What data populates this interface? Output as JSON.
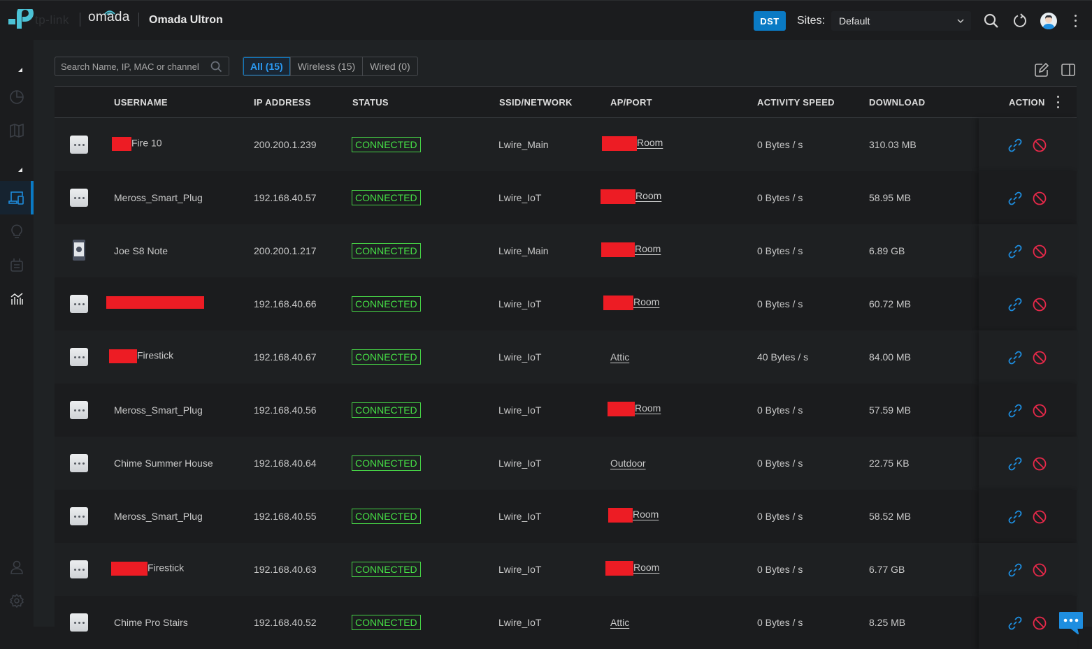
{
  "header": {
    "brand": "tp-link",
    "product": "omada",
    "app_title": "Omada Ultron",
    "dst_badge": "DST",
    "sites_label": "Sites:",
    "sites_selected": "Default"
  },
  "sidebar": {
    "items": [
      {
        "name": "dashboard",
        "icon": "pie-chart-icon",
        "active": false
      },
      {
        "name": "map",
        "icon": "map-icon",
        "active": false
      },
      {
        "name": "clients",
        "icon": "devices-icon",
        "active": true
      },
      {
        "name": "insights",
        "icon": "lightbulb-icon",
        "active": false
      },
      {
        "name": "logs",
        "icon": "log-icon",
        "active": false
      },
      {
        "name": "statistics",
        "icon": "chart-icon",
        "active": false
      },
      {
        "name": "account",
        "icon": "user-icon",
        "active": false
      },
      {
        "name": "settings",
        "icon": "gear-icon",
        "active": false
      }
    ]
  },
  "toolbar": {
    "search_placeholder": "Search Name, IP, MAC or channel",
    "filters": [
      {
        "label": "All (15)",
        "active": true
      },
      {
        "label": "Wireless (15)",
        "active": false
      },
      {
        "label": "Wired (0)",
        "active": false
      }
    ]
  },
  "table": {
    "columns": [
      "USERNAME",
      "IP ADDRESS",
      "STATUS",
      "SSID/NETWORK",
      "AP/PORT",
      "ACTIVITY SPEED",
      "DOWNLOAD",
      "ACTION"
    ],
    "rows": [
      {
        "icon": "more",
        "name": "Fire 10",
        "redact_name": 28,
        "ip": "200.200.1.239",
        "status": "CONNECTED",
        "ssid": "Lwire_Main",
        "ap": "Room",
        "redact_ap": 50,
        "speed": "0 Bytes / s",
        "download": "310.03 MB"
      },
      {
        "icon": "more",
        "name": "Meross_Smart_Plug",
        "redact_name": 0,
        "ip": "192.168.40.57",
        "status": "CONNECTED",
        "ssid": "Lwire_IoT",
        "ap": "Room",
        "redact_ap": 50,
        "speed": "0 Bytes / s",
        "download": "58.95 MB"
      },
      {
        "icon": "phone",
        "name": "Joe S8 Note",
        "redact_name": 0,
        "ip": "200.200.1.217",
        "status": "CONNECTED",
        "ssid": "Lwire_Main",
        "ap": "Room",
        "redact_ap": 48,
        "speed": "0 Bytes / s",
        "download": "6.89 GB"
      },
      {
        "icon": "more",
        "name": "",
        "redact_name": 140,
        "ip": "192.168.40.66",
        "status": "CONNECTED",
        "ssid": "Lwire_IoT",
        "ap": "Room",
        "redact_ap": 43,
        "speed": "0 Bytes / s",
        "download": "60.72 MB"
      },
      {
        "icon": "more",
        "name": "Firestick",
        "redact_name": 40,
        "ip": "192.168.40.67",
        "status": "CONNECTED",
        "ssid": "Lwire_IoT",
        "ap": "Attic",
        "redact_ap": 0,
        "speed": "40 Bytes / s",
        "download": "84.00 MB"
      },
      {
        "icon": "more",
        "name": "Meross_Smart_Plug",
        "redact_name": 0,
        "ip": "192.168.40.56",
        "status": "CONNECTED",
        "ssid": "Lwire_IoT",
        "ap": "Room",
        "redact_ap": 39,
        "speed": "0 Bytes / s",
        "download": "57.59 MB"
      },
      {
        "icon": "more",
        "name": "Chime Summer House",
        "redact_name": 0,
        "ip": "192.168.40.64",
        "status": "CONNECTED",
        "ssid": "Lwire_IoT",
        "ap": "Outdoor",
        "redact_ap": 0,
        "speed": "0 Bytes / s",
        "download": "22.75 KB"
      },
      {
        "icon": "more",
        "name": "Meross_Smart_Plug",
        "redact_name": 0,
        "ip": "192.168.40.55",
        "status": "CONNECTED",
        "ssid": "Lwire_IoT",
        "ap": "Room",
        "redact_ap": 35,
        "speed": "0 Bytes / s",
        "download": "58.52 MB"
      },
      {
        "icon": "more",
        "name": "Firestick",
        "redact_name": 52,
        "ip": "192.168.40.63",
        "status": "CONNECTED",
        "ssid": "Lwire_IoT",
        "ap": "Room",
        "redact_ap": 40,
        "speed": "0 Bytes / s",
        "download": "6.77 GB"
      },
      {
        "icon": "more",
        "name": "Chime Pro Stairs",
        "redact_name": 0,
        "ip": "192.168.40.52",
        "status": "CONNECTED",
        "ssid": "Lwire_IoT",
        "ap": "Attic",
        "redact_ap": 0,
        "speed": "0 Bytes / s",
        "download": "8.25 MB"
      }
    ]
  },
  "colors": {
    "accent": "#0a7ac4",
    "connected": "#46e046",
    "block": "#e8294a",
    "redaction": "#ed1c24"
  }
}
